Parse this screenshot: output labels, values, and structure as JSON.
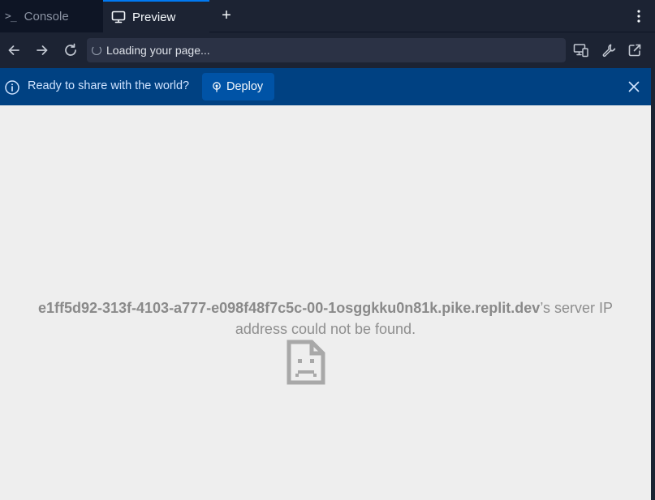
{
  "tabs": {
    "console_icon": ">_",
    "console_label": "Console",
    "preview_label": "Preview",
    "new_tab_label": "+"
  },
  "address_bar": {
    "status_text": "Loading your page..."
  },
  "banner": {
    "message": "Ready to share with the world?",
    "deploy_label": "Deploy"
  },
  "error": {
    "host": "e1ff5d92-313f-4103-a777-e098f48f7c5c-00-1osggkku0n81k.pike.replit.dev",
    "line1_suffix": "’s server IP",
    "line2": "address could not be found."
  },
  "icons": {
    "console_tab": "terminal-icon",
    "preview_tab": "monitor-icon",
    "more": "kebab-icon",
    "back": "arrow-left-icon",
    "forward": "arrow-right-icon",
    "reload": "reload-icon",
    "devices": "devices-icon",
    "devtools": "wrench-icon",
    "open_external": "external-link-icon",
    "info": "info-icon",
    "deploy": "deploy-icon",
    "close": "close-icon",
    "error": "sad-document-icon"
  },
  "colors": {
    "tabbar_bg": "#1c2333",
    "banner_bg": "#004182",
    "deploy_button_bg": "#0053a6",
    "viewport_bg": "#eeeeee",
    "active_tab_accent": "#0079f2"
  }
}
